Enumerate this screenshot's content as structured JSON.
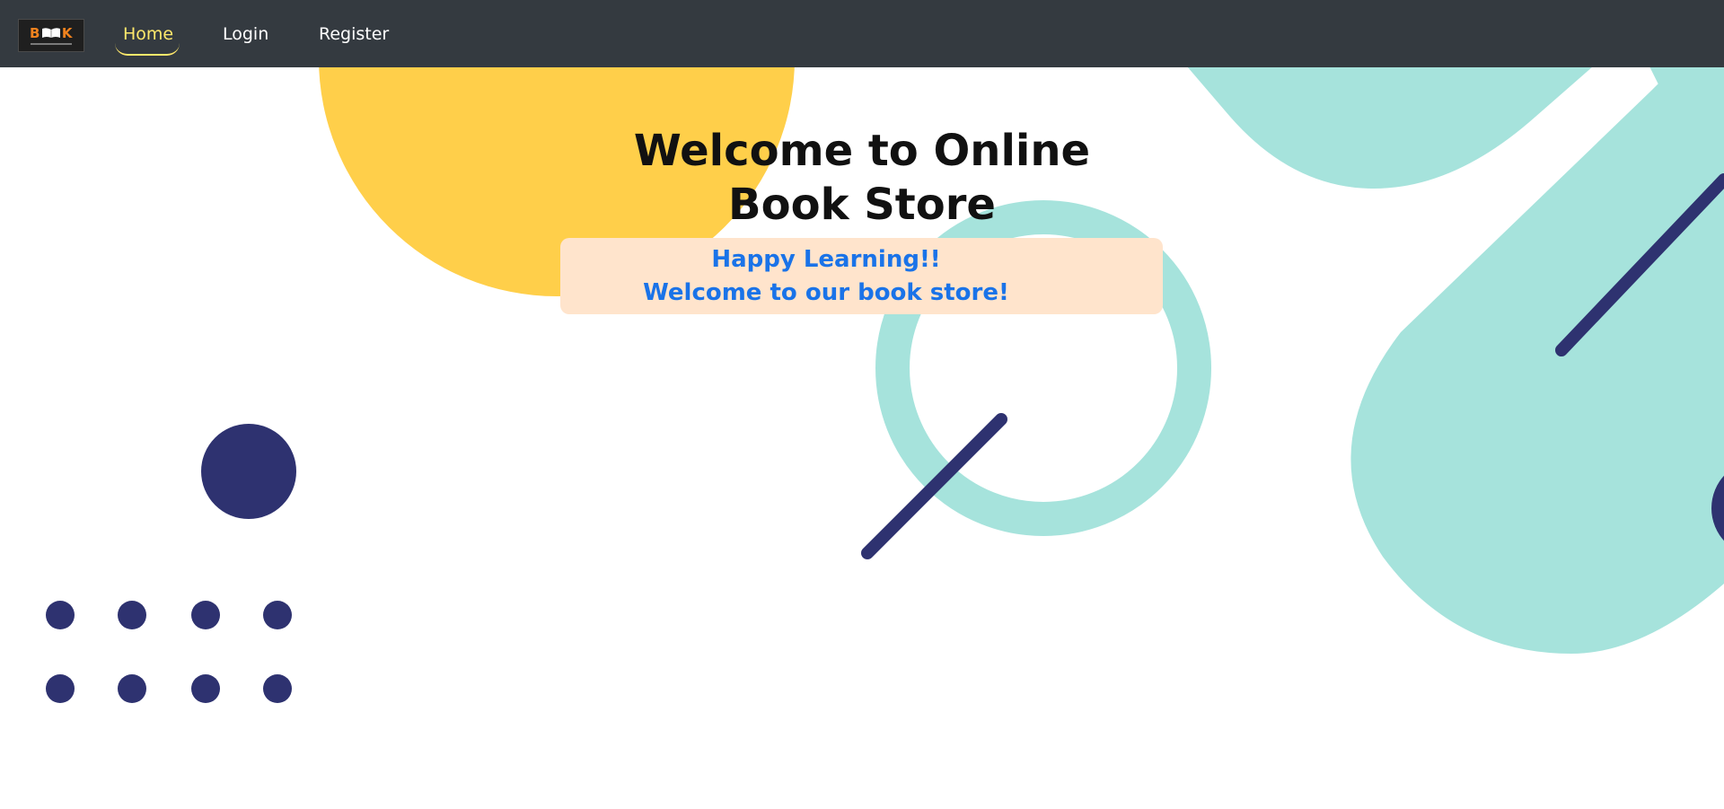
{
  "navbar": {
    "logo_text": "B  K",
    "items": [
      {
        "label": "Home",
        "active": true
      },
      {
        "label": "Login",
        "active": false
      },
      {
        "label": "Register",
        "active": false
      }
    ]
  },
  "hero": {
    "title_line1": "Welcome to Online",
    "title_line2": "Book Store"
  },
  "welcome_box": {
    "line1": "Happy Learning!!",
    "line2": "Welcome to our book store!"
  },
  "colors": {
    "navbar_bg": "#343a40",
    "active_nav": "#ffe86b",
    "yellow_shape": "#ffcf4a",
    "teal_shape": "#a6e3dc",
    "navy_shape": "#2e3270",
    "welcome_box_bg": "#ffe4cc",
    "welcome_text": "#1a73e8"
  }
}
